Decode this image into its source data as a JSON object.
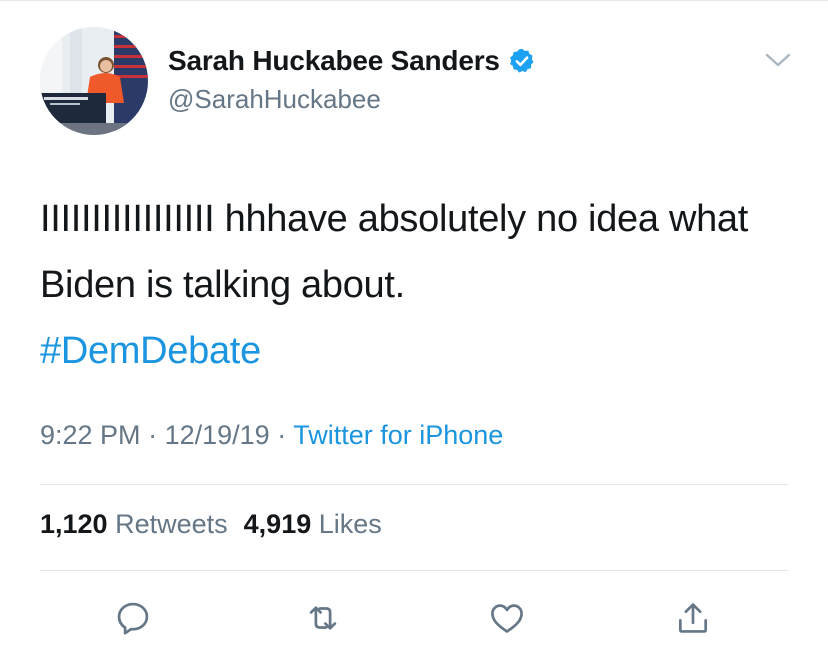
{
  "user": {
    "display_name": "Sarah Huckabee Sanders",
    "handle": "@SarahHuckabee",
    "verified": true
  },
  "tweet": {
    "text": "IIIIIIIIIIIIIIIII hhhave absolutely no idea what Biden is talking about.",
    "hashtag": "#DemDebate",
    "time": "9:22 PM",
    "date": "12/19/19",
    "separator": "·",
    "source": "Twitter for iPhone"
  },
  "stats": {
    "retweets_count": "1,120",
    "retweets_label": "Retweets",
    "likes_count": "4,919",
    "likes_label": "Likes"
  },
  "colors": {
    "link": "#1b95e0",
    "secondary_text": "#657786",
    "primary_text": "#14171a",
    "divider": "#e1e8ed",
    "verified_badge": "#1da1f2"
  },
  "icons": {
    "reply": "reply-icon",
    "retweet": "retweet-icon",
    "like": "like-icon",
    "share": "share-icon",
    "menu": "chevron-down-icon",
    "verified": "verified-badge-icon"
  }
}
